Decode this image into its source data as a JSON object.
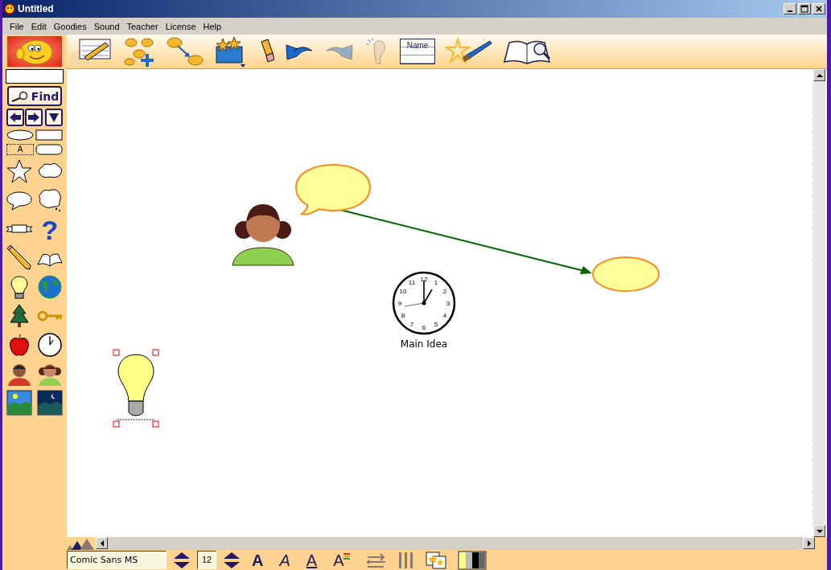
{
  "window": {
    "title": "Untitled"
  },
  "menu": [
    "File",
    "Edit",
    "Goodies",
    "Sound",
    "Teacher",
    "License",
    "Help"
  ],
  "toolbar": [
    {
      "kind": "note",
      "disabled": false
    },
    {
      "kind": "add-node",
      "disabled": false
    },
    {
      "kind": "link",
      "disabled": false
    },
    {
      "kind": "symbols",
      "disabled": false
    },
    {
      "kind": "eraser",
      "disabled": false
    },
    {
      "kind": "undo",
      "disabled": false
    },
    {
      "kind": "redo",
      "disabled": true
    },
    {
      "kind": "listen",
      "disabled": true
    },
    {
      "kind": "name",
      "label": "Name",
      "disabled": false
    },
    {
      "kind": "paint",
      "disabled": false
    },
    {
      "kind": "book",
      "disabled": false
    }
  ],
  "sidebar": {
    "find_button": "Find",
    "text_tool": "A",
    "question_glyph": "?",
    "palette": [
      {
        "kind": "star"
      },
      {
        "kind": "cloud"
      },
      {
        "kind": "speech"
      },
      {
        "kind": "thought"
      },
      {
        "kind": "banner"
      },
      {
        "kind": "question"
      },
      {
        "kind": "pencil"
      },
      {
        "kind": "book"
      },
      {
        "kind": "bulb"
      },
      {
        "kind": "globe"
      },
      {
        "kind": "tree"
      },
      {
        "kind": "key"
      },
      {
        "kind": "apple"
      },
      {
        "kind": "clock"
      },
      {
        "kind": "boy"
      },
      {
        "kind": "girl"
      },
      {
        "kind": "day"
      },
      {
        "kind": "night"
      }
    ]
  },
  "canvas": {
    "items": [
      {
        "kind": "bubble",
        "selected": false
      },
      {
        "kind": "person",
        "selected": false
      },
      {
        "kind": "ellipse",
        "selected": false
      },
      {
        "kind": "clock",
        "selected": false,
        "label": "Main Idea",
        "numbers": [
          "12",
          "11",
          "1",
          "10",
          "2",
          "9",
          "3",
          "8",
          "4",
          "7",
          "5",
          "6"
        ]
      },
      {
        "kind": "bulb",
        "selected": true
      }
    ]
  },
  "format_bar": {
    "font": "Comic Sans MS",
    "size": "12",
    "style_buttons": [
      {
        "kind": "bold",
        "label": "A"
      },
      {
        "kind": "italic",
        "label": "A"
      },
      {
        "kind": "underline",
        "label": "A"
      },
      {
        "kind": "color",
        "label": "A"
      }
    ]
  }
}
